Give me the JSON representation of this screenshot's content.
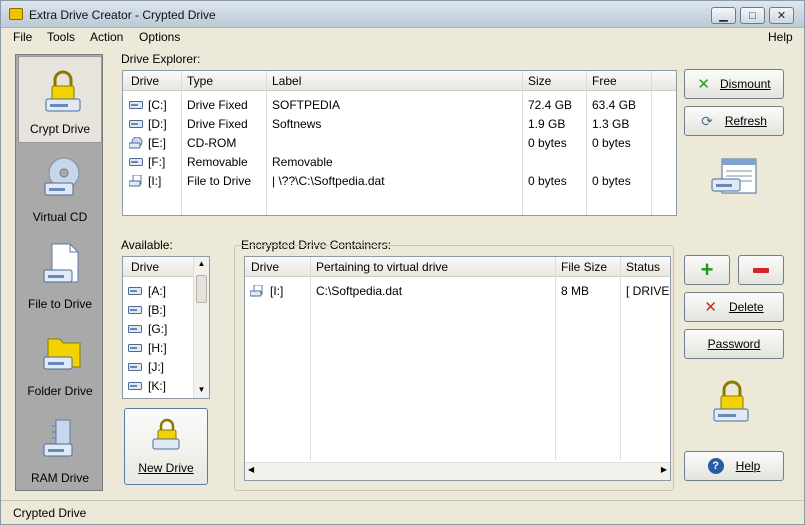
{
  "window": {
    "title": "Extra Drive Creator - Crypted Drive"
  },
  "menu": [
    "File",
    "Tools",
    "Action",
    "Options",
    "Help"
  ],
  "sidebar": {
    "items": [
      {
        "label": "Crypt Drive",
        "active": true
      },
      {
        "label": "Virtual CD"
      },
      {
        "label": "File to Drive"
      },
      {
        "label": "Folder Drive"
      },
      {
        "label": "RAM Drive"
      }
    ]
  },
  "explorer": {
    "title": "Drive Explorer:",
    "columns": [
      "Drive",
      "Type",
      "Label",
      "Size",
      "Free"
    ],
    "rows": [
      {
        "drive": "[C:]",
        "type": "Drive Fixed",
        "label": "SOFTPEDIA",
        "size": "72.4 GB",
        "free": "63.4 GB"
      },
      {
        "drive": "[D:]",
        "type": "Drive Fixed",
        "label": "Softnews",
        "size": "1.9 GB",
        "free": "1.3 GB"
      },
      {
        "drive": "[E:]",
        "type": "CD-ROM",
        "label": "",
        "size": "0 bytes",
        "free": "0 bytes"
      },
      {
        "drive": "[F:]",
        "type": "Removable",
        "label": "Removable",
        "size": "",
        "free": ""
      },
      {
        "drive": "[I:]",
        "type": "File to Drive",
        "label": "| \\??\\C:\\Softpedia.dat",
        "size": "0 bytes",
        "free": "0 bytes"
      }
    ]
  },
  "available": {
    "title": "Available:",
    "column": "Drive",
    "items": [
      "[A:]",
      "[B:]",
      "[G:]",
      "[H:]",
      "[J:]",
      "[K:]"
    ]
  },
  "containers": {
    "title": "Encrypted Drive Containers:",
    "columns": [
      "Drive",
      "Pertaining to virtual drive",
      "File Size",
      "Status"
    ],
    "rows": [
      {
        "drive": "[I:]",
        "path": "C:\\Softpedia.dat",
        "size": "8 MB",
        "status": "[ DRIVE IS"
      }
    ]
  },
  "buttons": {
    "dismount": "Dismount",
    "refresh": "Refresh",
    "new_drive": "New Drive",
    "delete": "Delete",
    "password": "Password",
    "help": "Help"
  },
  "status": {
    "text": "Crypted Drive"
  }
}
